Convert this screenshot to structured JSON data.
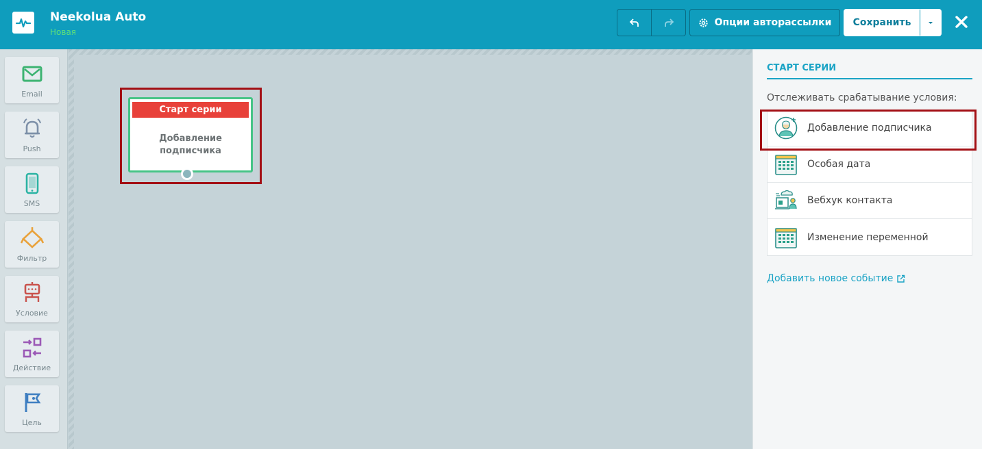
{
  "header": {
    "title": "Neekolua Auto",
    "subtitle": "Новая",
    "options_label": "Опции авторассылки",
    "save_label": "Сохранить"
  },
  "toolbox": {
    "items": [
      {
        "label": "Email",
        "icon": "email-icon",
        "color": "#3cb371"
      },
      {
        "label": "Push",
        "icon": "bell-icon",
        "color": "#7d90a8"
      },
      {
        "label": "SMS",
        "icon": "phone-icon",
        "color": "#2ab3a3"
      },
      {
        "label": "Фильтр",
        "icon": "filter-icon",
        "color": "#e9a23b"
      },
      {
        "label": "Условие",
        "icon": "condition-icon",
        "color": "#c9534d"
      },
      {
        "label": "Действие",
        "icon": "action-icon",
        "color": "#9b59b6"
      },
      {
        "label": "Цель",
        "icon": "flag-icon",
        "color": "#3f7fc1"
      }
    ]
  },
  "canvas": {
    "node": {
      "head": "Старт серии",
      "body_line1": "Добавление",
      "body_line2": "подписчика"
    }
  },
  "panel": {
    "title": "СТАРТ СЕРИИ",
    "subtitle": "Отслеживать срабатывание условия:",
    "triggers": [
      {
        "label": "Добавление подписчика",
        "icon": "add-subscriber-icon"
      },
      {
        "label": "Особая дата",
        "icon": "calendar-icon"
      },
      {
        "label": "Вебхук контакта",
        "icon": "webhook-icon"
      },
      {
        "label": "Изменение переменной",
        "icon": "calendar-icon"
      }
    ],
    "add_event_label": "Добавить новое событие"
  }
}
